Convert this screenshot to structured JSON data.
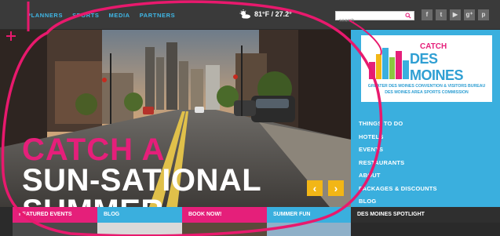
{
  "nav": {
    "items": [
      "PLANNERS",
      "SPORTS",
      "MEDIA",
      "PARTNERS"
    ]
  },
  "weather": {
    "text": "81°F / 27.2°",
    "icon": "sun-cloud-icon"
  },
  "search": {
    "placeholder": "search"
  },
  "social": {
    "icons": [
      "facebook-icon",
      "twitter-icon",
      "youtube-icon",
      "google-plus-icon",
      "pinterest-icon"
    ],
    "glyphs": [
      "f",
      "t",
      "▶",
      "g⁺",
      "p"
    ]
  },
  "hero": {
    "line1": "CATCH A",
    "line2": "SUN-SATIONAL",
    "line3": "SUMMER",
    "prev": "‹",
    "next": "›"
  },
  "logo": {
    "catch": "CATCH",
    "des_moines": "DES MOINES",
    "tagline1": "GREATER DES MOINES CONVENTION & VISITORS BUREAU",
    "tagline2": "DES MOINES AREA SPORTS COMMISSION"
  },
  "sidebar": {
    "items": [
      "THINGS TO DO",
      "HOTELS",
      "EVENTS",
      "RESTAURANTS",
      "ABOUT",
      "PACKAGES & DISCOUNTS",
      "BLOG"
    ]
  },
  "tabs": {
    "featured": "FEATURED EVENTS",
    "blog": "BLOG",
    "book": "BOOK NOW!",
    "summer": "SUMMER FUN",
    "spotlight": "DES MOINES SPOTLIGHT"
  },
  "colors": {
    "brand_pink": "#e51f7a",
    "brand_blue": "#3aafde",
    "accent_yellow": "#f2b616",
    "topbar": "#3a3a3a"
  }
}
